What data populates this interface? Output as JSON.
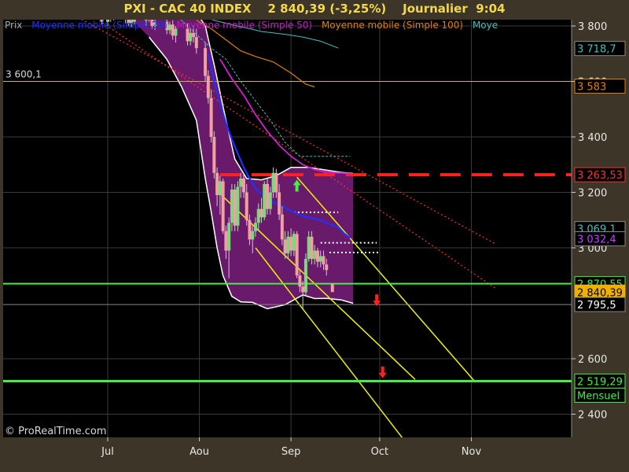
{
  "header": {
    "title": "PXI - CAC 40 INDEX    2 840,39 (-3,25%)    Journalier  9:04"
  },
  "legend": [
    {
      "label": "Prix",
      "color": "#a8a8a8"
    },
    {
      "label": "Moyenne mobile (Simple 20)",
      "color": "#2030ff"
    },
    {
      "label": "Moyenne mobile (Simple 50)",
      "color": "#c020c0"
    },
    {
      "label": "Moyenne mobile (Simple 100)",
      "color": "#e08000"
    },
    {
      "label": "Moye",
      "color": "#40c0c0"
    }
  ],
  "copyright": "© ProRealTime.com",
  "colors": {
    "background": "#000000",
    "frame": "#3d3527",
    "band_fill": "#6a1a6a",
    "up_candle": "#7ed87e",
    "down_candle": "#f0a0a0",
    "green_line": "#44ee44",
    "yellow_line": "#f0f000",
    "red_dash": "#ff2020"
  },
  "chart_data": {
    "type": "candlestick",
    "title": "PXI - CAC 40 INDEX",
    "timeframe": "Journalier",
    "last_price": "2 840,39",
    "change": "-3,25%",
    "time": "9:04",
    "y_range": [
      2300,
      3850
    ],
    "y_ticks": [
      {
        "value": 3800,
        "label": "3 800"
      },
      {
        "value": 3600,
        "label": "3 600"
      },
      {
        "value": 3400,
        "label": "3 400"
      },
      {
        "value": 3200,
        "label": "3 200"
      },
      {
        "value": 3000,
        "label": "3 000"
      },
      {
        "value": 2600,
        "label": "2 600"
      },
      {
        "value": 2400,
        "label": "2 400"
      }
    ],
    "x_ticks": [
      {
        "label": "Jul",
        "day": 0
      },
      {
        "label": "Aou",
        "day": 31
      },
      {
        "label": "Sep",
        "day": 62
      },
      {
        "label": "Oct",
        "day": 92
      },
      {
        "label": "Nov",
        "day": 123
      }
    ],
    "price_tags": [
      {
        "value": 3718.7,
        "label": "3 718,7",
        "bg": "#000000",
        "fg": "#40c0c0",
        "border": "#888888"
      },
      {
        "value": 3583,
        "label": "3 583",
        "bg": "#000000",
        "fg": "#e08000",
        "border": "#e08000"
      },
      {
        "value": 3263.53,
        "label": "3 263,53",
        "bg": "#000000",
        "fg": "#ff3030",
        "border": "#ff3030"
      },
      {
        "value": 3069.1,
        "label": "3 069,1",
        "bg": "#000000",
        "fg": "#40c0c0",
        "border": "#888888"
      },
      {
        "value": 3032.4,
        "label": "3 032,4",
        "bg": "#000000",
        "fg": "#c040ff",
        "border": "#888888"
      },
      {
        "value": 2870.55,
        "label": "2 870,55",
        "bg": "#000000",
        "fg": "#44ee44",
        "border": "#44ee44"
      },
      {
        "value": 2840.39,
        "label": "2 840,39",
        "bg": "#f0b000",
        "fg": "#000000",
        "border": "#f0b000"
      },
      {
        "value": 2795.5,
        "label": "2 795,5",
        "bg": "#000000",
        "fg": "#ffffff",
        "border": "#888888"
      },
      {
        "value": 2519.29,
        "label": "2 519,29",
        "bg": "#000000",
        "fg": "#44ee44",
        "border": "#44ee44"
      }
    ],
    "tag_notes": {
      "mensuel": "Mensuel"
    },
    "left_label": {
      "value": 3600.1,
      "label": "3 600,1"
    },
    "horizontal_lines": [
      {
        "value": 3600.1,
        "color": "#c8b060",
        "width": 1
      },
      {
        "value": 2870.55,
        "color": "#44ee44",
        "width": 2
      },
      {
        "value": 2795.5,
        "color": "#888888",
        "width": 1
      },
      {
        "value": 2519.29,
        "color": "#44ee44",
        "width": 3
      }
    ],
    "red_dashed_level": {
      "value": 3263.53,
      "x_from_day": 38
    },
    "white_dotted_levels": [
      {
        "value": 3128,
        "x_from_day": 63,
        "x_to_day": 78
      },
      {
        "value": 3018,
        "x_from_day": 72,
        "x_to_day": 91
      },
      {
        "value": 2983,
        "x_from_day": 75,
        "x_to_day": 92
      }
    ],
    "yellow_channel": [
      {
        "from": [
          38,
          3195
        ],
        "to": [
          104,
          2525
        ]
      },
      {
        "from": [
          64,
          3255
        ],
        "to": [
          124,
          2520
        ]
      },
      {
        "from": [
          50,
          3000
        ],
        "to": [
          100,
          2310
        ]
      }
    ],
    "red_trendlines": [
      {
        "from": [
          -10,
          3830
        ],
        "to": [
          131,
          3015
        ]
      },
      {
        "from": [
          -5,
          3835
        ],
        "to": [
          131,
          2855
        ]
      }
    ],
    "signals": [
      {
        "type": "up",
        "day": 64,
        "value": 3220,
        "color": "#44ee44"
      },
      {
        "type": "down",
        "day": 91,
        "value": 2815,
        "color": "#ff2020"
      },
      {
        "type": "down",
        "day": 93,
        "value": 2555,
        "color": "#ff2020"
      }
    ],
    "band_upper": [
      [
        -10,
        3850
      ],
      [
        20,
        3850
      ],
      [
        30,
        3850
      ],
      [
        33,
        3800
      ],
      [
        36,
        3660
      ],
      [
        40,
        3460
      ],
      [
        43,
        3320
      ],
      [
        47,
        3250
      ],
      [
        52,
        3245
      ],
      [
        57,
        3260
      ],
      [
        62,
        3290
      ],
      [
        68,
        3290
      ],
      [
        74,
        3280
      ],
      [
        79,
        3272
      ],
      [
        83,
        3268
      ]
    ],
    "band_lower": [
      [
        83,
        2800
      ],
      [
        79,
        2812
      ],
      [
        74,
        2818
      ],
      [
        70,
        2817
      ],
      [
        66,
        2830
      ],
      [
        60,
        2795
      ],
      [
        54,
        2780
      ],
      [
        49,
        2803
      ],
      [
        45,
        2805
      ],
      [
        42,
        2825
      ],
      [
        39,
        2900
      ],
      [
        37,
        3000
      ],
      [
        35,
        3130
      ],
      [
        33,
        3250
      ],
      [
        30,
        3460
      ],
      [
        25,
        3580
      ],
      [
        20,
        3680
      ],
      [
        14,
        3760
      ],
      [
        8,
        3825
      ],
      [
        0,
        3850
      ],
      [
        -10,
        3850
      ]
    ],
    "sma20": [
      [
        34,
        3700
      ],
      [
        36,
        3600
      ],
      [
        38,
        3520
      ],
      [
        40,
        3450
      ],
      [
        42,
        3390
      ],
      [
        44,
        3340
      ],
      [
        46,
        3290
      ],
      [
        48,
        3250
      ],
      [
        50,
        3215
      ],
      [
        52,
        3195
      ],
      [
        54,
        3180
      ],
      [
        56,
        3165
      ],
      [
        58,
        3155
      ],
      [
        60,
        3145
      ],
      [
        62,
        3133
      ],
      [
        64,
        3123
      ],
      [
        66,
        3115
      ],
      [
        68,
        3110
      ],
      [
        70,
        3105
      ],
      [
        72,
        3100
      ],
      [
        74,
        3090
      ],
      [
        76,
        3082
      ],
      [
        78,
        3075
      ],
      [
        80,
        3052
      ],
      [
        82,
        3035
      ]
    ],
    "sma50": [
      [
        38,
        3680
      ],
      [
        42,
        3610
      ],
      [
        46,
        3550
      ],
      [
        50,
        3480
      ],
      [
        54,
        3420
      ],
      [
        58,
        3370
      ],
      [
        62,
        3330
      ],
      [
        66,
        3300
      ],
      [
        70,
        3282
      ],
      [
        74,
        3273
      ],
      [
        78,
        3270
      ],
      [
        82,
        3268
      ]
    ],
    "sma100": [
      [
        30,
        3820
      ],
      [
        35,
        3790
      ],
      [
        40,
        3750
      ],
      [
        45,
        3710
      ],
      [
        50,
        3690
      ],
      [
        56,
        3670
      ],
      [
        62,
        3630
      ],
      [
        67,
        3590
      ],
      [
        70,
        3580
      ]
    ],
    "teal_ma": [
      [
        20,
        3850
      ],
      [
        25,
        3820
      ],
      [
        30,
        3770
      ],
      [
        35,
        3720
      ],
      [
        40,
        3680
      ],
      [
        45,
        3600
      ],
      [
        50,
        3530
      ],
      [
        55,
        3460
      ],
      [
        60,
        3380
      ],
      [
        65,
        3330
      ],
      [
        70,
        3330
      ],
      [
        75,
        3330
      ],
      [
        80,
        3330
      ],
      [
        82,
        3330
      ]
    ],
    "teal_ma_top": [
      [
        20,
        3850
      ],
      [
        28,
        3850
      ],
      [
        36,
        3820
      ],
      [
        44,
        3800
      ],
      [
        52,
        3780
      ],
      [
        60,
        3770
      ],
      [
        66,
        3760
      ],
      [
        72,
        3745
      ],
      [
        78,
        3720
      ]
    ],
    "candles": [
      {
        "d": -2,
        "o": 3840,
        "h": 3855,
        "l": 3805,
        "c": 3815
      },
      {
        "d": 0,
        "o": 3815,
        "h": 3840,
        "l": 3800,
        "c": 3825
      },
      {
        "d": 1,
        "o": 3825,
        "h": 3845,
        "l": 3815,
        "c": 3835
      },
      {
        "d": 2,
        "o": 3835,
        "h": 3850,
        "l": 3820,
        "c": 3830
      },
      {
        "d": 6,
        "o": 3835,
        "h": 3855,
        "l": 3810,
        "c": 3840
      },
      {
        "d": 7,
        "o": 3840,
        "h": 3850,
        "l": 3800,
        "c": 3810
      },
      {
        "d": 8,
        "o": 3810,
        "h": 3830,
        "l": 3795,
        "c": 3825
      },
      {
        "d": 9,
        "o": 3825,
        "h": 3840,
        "l": 3805,
        "c": 3815
      },
      {
        "d": 13,
        "o": 3820,
        "h": 3840,
        "l": 3800,
        "c": 3835
      },
      {
        "d": 14,
        "o": 3835,
        "h": 3850,
        "l": 3815,
        "c": 3825
      },
      {
        "d": 15,
        "o": 3825,
        "h": 3845,
        "l": 3790,
        "c": 3800
      },
      {
        "d": 16,
        "o": 3800,
        "h": 3825,
        "l": 3785,
        "c": 3815
      },
      {
        "d": 20,
        "o": 3815,
        "h": 3835,
        "l": 3770,
        "c": 3785
      },
      {
        "d": 21,
        "o": 3785,
        "h": 3815,
        "l": 3770,
        "c": 3805
      },
      {
        "d": 22,
        "o": 3805,
        "h": 3820,
        "l": 3750,
        "c": 3765
      },
      {
        "d": 23,
        "o": 3765,
        "h": 3800,
        "l": 3740,
        "c": 3790
      },
      {
        "d": 27,
        "o": 3790,
        "h": 3810,
        "l": 3730,
        "c": 3745
      },
      {
        "d": 28,
        "o": 3745,
        "h": 3790,
        "l": 3730,
        "c": 3775
      },
      {
        "d": 29,
        "o": 3775,
        "h": 3800,
        "l": 3740,
        "c": 3760
      },
      {
        "d": 30,
        "o": 3760,
        "h": 3790,
        "l": 3700,
        "c": 3720
      },
      {
        "d": 33,
        "o": 3720,
        "h": 3740,
        "l": 3600,
        "c": 3620
      },
      {
        "d": 34,
        "o": 3620,
        "h": 3640,
        "l": 3520,
        "c": 3540
      },
      {
        "d": 35,
        "o": 3540,
        "h": 3570,
        "l": 3380,
        "c": 3400
      },
      {
        "d": 36,
        "o": 3400,
        "h": 3420,
        "l": 3250,
        "c": 3270
      },
      {
        "d": 37,
        "o": 3270,
        "h": 3290,
        "l": 3150,
        "c": 3190
      },
      {
        "d": 38,
        "o": 3190,
        "h": 3260,
        "l": 3120,
        "c": 3240
      },
      {
        "d": 39,
        "o": 3240,
        "h": 3250,
        "l": 3050,
        "c": 3060
      },
      {
        "d": 40,
        "o": 3060,
        "h": 3080,
        "l": 2960,
        "c": 2990
      },
      {
        "d": 41,
        "o": 2990,
        "h": 3110,
        "l": 2890,
        "c": 3090
      },
      {
        "d": 42,
        "o": 3090,
        "h": 3230,
        "l": 3060,
        "c": 3210
      },
      {
        "d": 43,
        "o": 3210,
        "h": 3230,
        "l": 3060,
        "c": 3080
      },
      {
        "d": 44,
        "o": 3080,
        "h": 3240,
        "l": 3060,
        "c": 3220
      },
      {
        "d": 45,
        "o": 3220,
        "h": 3270,
        "l": 3180,
        "c": 3250
      },
      {
        "d": 46,
        "o": 3250,
        "h": 3270,
        "l": 3180,
        "c": 3200
      },
      {
        "d": 47,
        "o": 3200,
        "h": 3230,
        "l": 3080,
        "c": 3100
      },
      {
        "d": 48,
        "o": 3100,
        "h": 3120,
        "l": 3010,
        "c": 3030
      },
      {
        "d": 49,
        "o": 3030,
        "h": 3080,
        "l": 2980,
        "c": 3060
      },
      {
        "d": 50,
        "o": 3060,
        "h": 3110,
        "l": 3040,
        "c": 3090
      },
      {
        "d": 51,
        "o": 3090,
        "h": 3160,
        "l": 3060,
        "c": 3140
      },
      {
        "d": 52,
        "o": 3140,
        "h": 3180,
        "l": 3090,
        "c": 3110
      },
      {
        "d": 53,
        "o": 3110,
        "h": 3240,
        "l": 3100,
        "c": 3230
      },
      {
        "d": 54,
        "o": 3230,
        "h": 3250,
        "l": 3120,
        "c": 3140
      },
      {
        "d": 55,
        "o": 3140,
        "h": 3220,
        "l": 3120,
        "c": 3200
      },
      {
        "d": 56,
        "o": 3200,
        "h": 3290,
        "l": 3180,
        "c": 3270
      },
      {
        "d": 57,
        "o": 3270,
        "h": 3285,
        "l": 3180,
        "c": 3200
      },
      {
        "d": 58,
        "o": 3200,
        "h": 3230,
        "l": 3100,
        "c": 3120
      },
      {
        "d": 59,
        "o": 3120,
        "h": 3150,
        "l": 3010,
        "c": 3030
      },
      {
        "d": 60,
        "o": 3030,
        "h": 3060,
        "l": 2960,
        "c": 2980
      },
      {
        "d": 61,
        "o": 2980,
        "h": 3060,
        "l": 2960,
        "c": 3040
      },
      {
        "d": 62,
        "o": 3040,
        "h": 3070,
        "l": 2970,
        "c": 2990
      },
      {
        "d": 63,
        "o": 2990,
        "h": 3060,
        "l": 2970,
        "c": 3050
      },
      {
        "d": 64,
        "o": 3050,
        "h": 3060,
        "l": 2890,
        "c": 2900
      },
      {
        "d": 65,
        "o": 2900,
        "h": 2920,
        "l": 2840,
        "c": 2860
      },
      {
        "d": 66,
        "o": 2860,
        "h": 2880,
        "l": 2780,
        "c": 2840
      },
      {
        "d": 67,
        "o": 2840,
        "h": 2980,
        "l": 2830,
        "c": 2960
      },
      {
        "d": 68,
        "o": 2960,
        "h": 3060,
        "l": 2950,
        "c": 3040
      },
      {
        "d": 69,
        "o": 3040,
        "h": 3060,
        "l": 2940,
        "c": 2960
      },
      {
        "d": 70,
        "o": 2960,
        "h": 3010,
        "l": 2940,
        "c": 2990
      },
      {
        "d": 71,
        "o": 2990,
        "h": 3000,
        "l": 2930,
        "c": 2950
      },
      {
        "d": 72,
        "o": 2950,
        "h": 2990,
        "l": 2930,
        "c": 2970
      },
      {
        "d": 73,
        "o": 2970,
        "h": 2990,
        "l": 2920,
        "c": 2940
      },
      {
        "d": 74,
        "o": 2940,
        "h": 2960,
        "l": 2900,
        "c": 2920
      }
    ]
  }
}
